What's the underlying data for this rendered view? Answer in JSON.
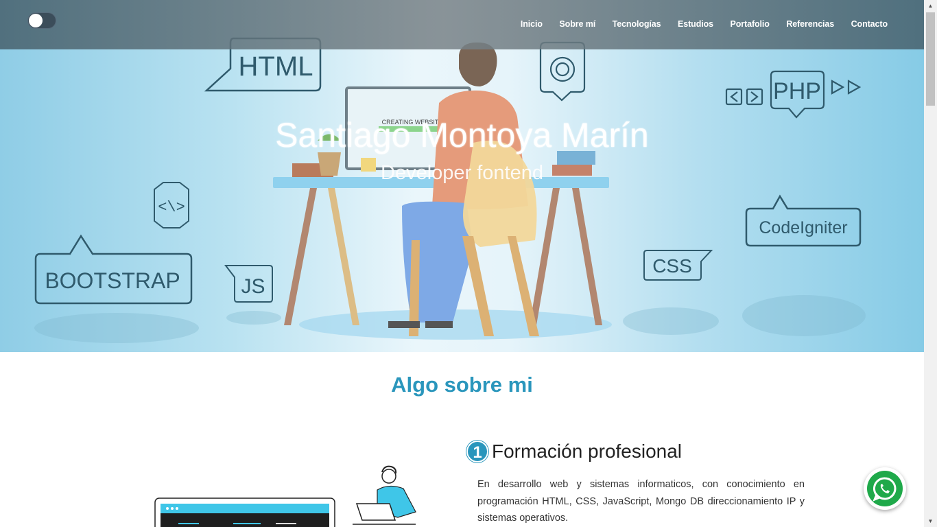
{
  "nav": {
    "items": [
      "Inicio",
      "Sobre mí",
      "Tecnologías",
      "Estudios",
      "Portafolio",
      "Referencias",
      "Contacto"
    ]
  },
  "hero": {
    "title": "Santiago Montoya Marín",
    "subtitle": "Developer fontend",
    "bubbles": {
      "html": "HTML",
      "php": "PHP",
      "bootstrap": "BOOTSTRAP",
      "js": "JS",
      "css": "CSS",
      "codeigniter": "CodeIgniter",
      "code": "<\\>",
      "monitor": "CREATING WEBSITE"
    }
  },
  "about": {
    "section_title": "Algo sobre mi",
    "item_number": "1",
    "item_title": "Formación profesional",
    "item_text": "En desarrollo web y sistemas informaticos, con conocimiento en programación HTML, CSS, JavaScript, Mongo DB direccionamiento IP y sistemas operativos."
  },
  "icons": {
    "theme_toggle": "toggle-switch",
    "whatsapp": "whatsapp-icon"
  },
  "colors": {
    "accent": "#2a96bc",
    "whatsapp": "#1fa94a",
    "navbar": "#46606c"
  }
}
